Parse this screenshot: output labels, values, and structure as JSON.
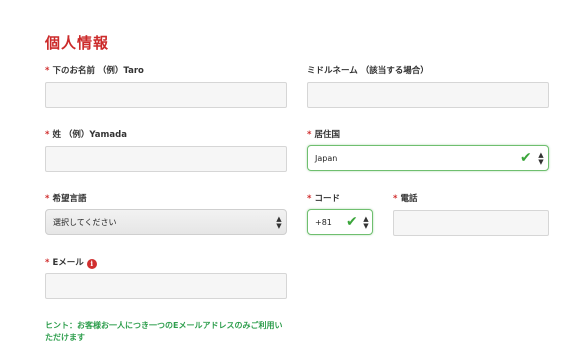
{
  "form": {
    "title": "個人情報",
    "required_mark": "*",
    "fields": {
      "first_name": {
        "label": "下のお名前 （例）Taro",
        "value": ""
      },
      "middle_name": {
        "label": "ミドルネーム （該当する場合）",
        "value": ""
      },
      "last_name": {
        "label": "姓 （例）Yamada",
        "value": ""
      },
      "country": {
        "label": "居住国",
        "value": "Japan"
      },
      "language": {
        "label": "希望言語",
        "value": "選択してください"
      },
      "country_code": {
        "label": "コード",
        "value": "+81"
      },
      "phone": {
        "label": "電話",
        "value": ""
      },
      "email": {
        "label": "Eメール",
        "value": "",
        "info_glyph": "i"
      }
    },
    "hint": "ヒント：お客様お一人につき一つのEメールアドレスのみご利用いただけます"
  },
  "icons": {
    "check": "✔",
    "up": "▲",
    "down": "▼"
  },
  "colors": {
    "title": "#cc2b2b",
    "required": "#d12f2f",
    "valid": "#3aa53a",
    "hint": "#2e9e4d"
  }
}
